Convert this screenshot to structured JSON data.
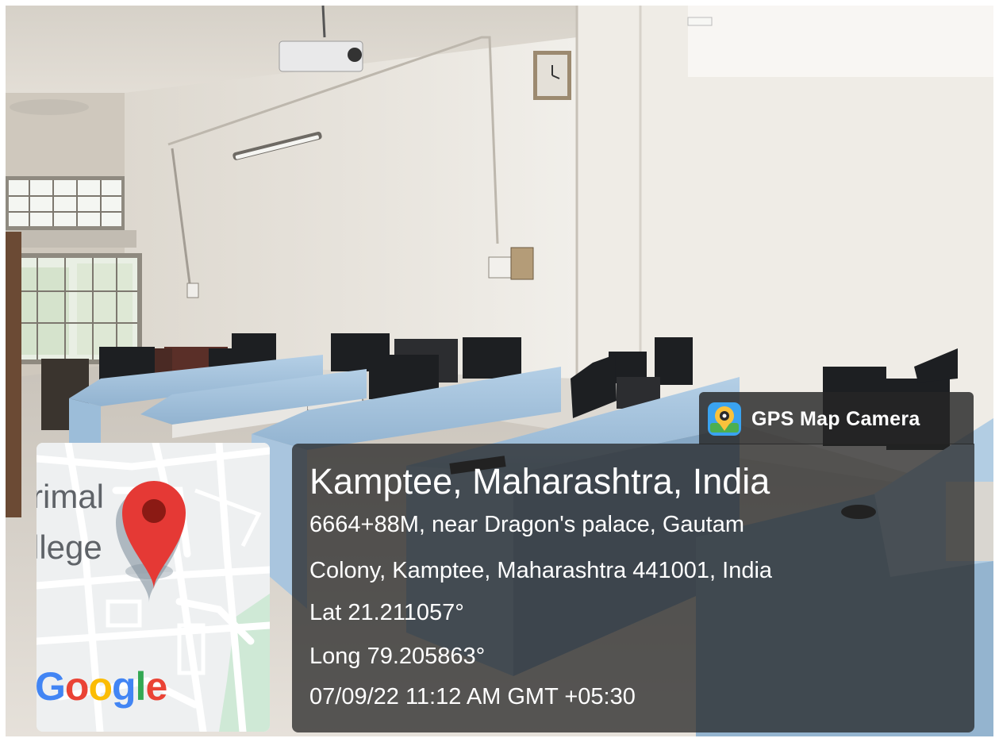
{
  "overlay": {
    "app_name": "GPS Map Camera",
    "place_title": "Kamptee, Maharashtra, India",
    "address_line_1": "6664+88M, near Dragon's palace, Gautam",
    "address_line_2": "Colony, Kamptee, Maharashtra 441001, India",
    "latitude": "Lat 21.211057°",
    "longitude": "Long 79.205863°",
    "datetime": "07/09/22 11:12 AM GMT +05:30"
  },
  "map": {
    "label_line_1": "rimal",
    "label_line_2": "llege",
    "logo_letters": [
      {
        "char": "G",
        "color": "#4285f4"
      },
      {
        "char": "o",
        "color": "#ea4335"
      },
      {
        "char": "o",
        "color": "#fbbc05"
      },
      {
        "char": "g",
        "color": "#4285f4"
      },
      {
        "char": "l",
        "color": "#34a853"
      },
      {
        "char": "e",
        "color": "#ea4335"
      }
    ],
    "pin_color": "#e53935"
  },
  "scene": {
    "description_icons": [
      "projector",
      "wall-clock",
      "tube-light",
      "window",
      "computer-monitor",
      "desk-partition"
    ]
  }
}
